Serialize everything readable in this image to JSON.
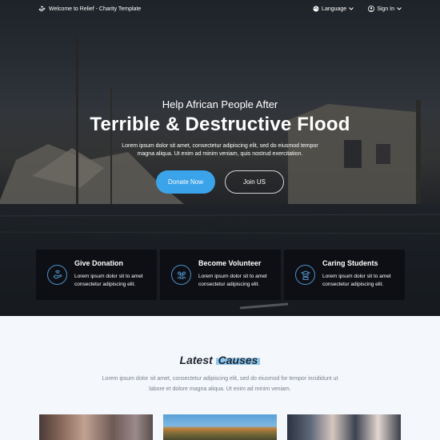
{
  "topbar": {
    "welcome": "Welcome to Relief - Charity Template",
    "language": "Language",
    "signin": "Sign In",
    "icons": {
      "welcome": "hand-heart-icon",
      "language": "globe-icon",
      "signin": "user-icon",
      "dropdown": "chevron-down-icon"
    }
  },
  "hero": {
    "subtitle": "Help African People After",
    "title": "Terrible & Destructive Flood",
    "desc_line1": "Lorem ipsum dolor sit amet, consectetur adipiscing elit, sed do eiusmod tempor",
    "desc_line2": "magna aliqua. Ut enim ad minim veniam, quis nostrud exercitation.",
    "donate_label": "Donate Now",
    "join_label": "Join US",
    "accent": "#3aa3ea"
  },
  "features": [
    {
      "title": "Give Donation",
      "line1": "Lorem ipsum dolor sit to amet",
      "line2": "consectetur adipiscing elit.",
      "icon": "donation-hand-icon"
    },
    {
      "title": "Become Volunteer",
      "line1": "Lorem ipsum dolor sit to amet",
      "line2": "consectetur adipiscing elit.",
      "icon": "volunteer-group-icon"
    },
    {
      "title": "Caring Students",
      "line1": "Lorem ipsum dolor sit to amet",
      "line2": "consectetur adipiscing elit.",
      "icon": "student-icon"
    }
  ],
  "causes": {
    "title_plain": "Latest",
    "title_highlight": "Causes",
    "desc_line1": "Lorem ipsum dolor sit amet, consectetur adipiscing elit, sed do eiusmod for tempor incididunt ut",
    "desc_line2": "labore et dolore magna aliqua. Ut enim ad minim veniam."
  }
}
